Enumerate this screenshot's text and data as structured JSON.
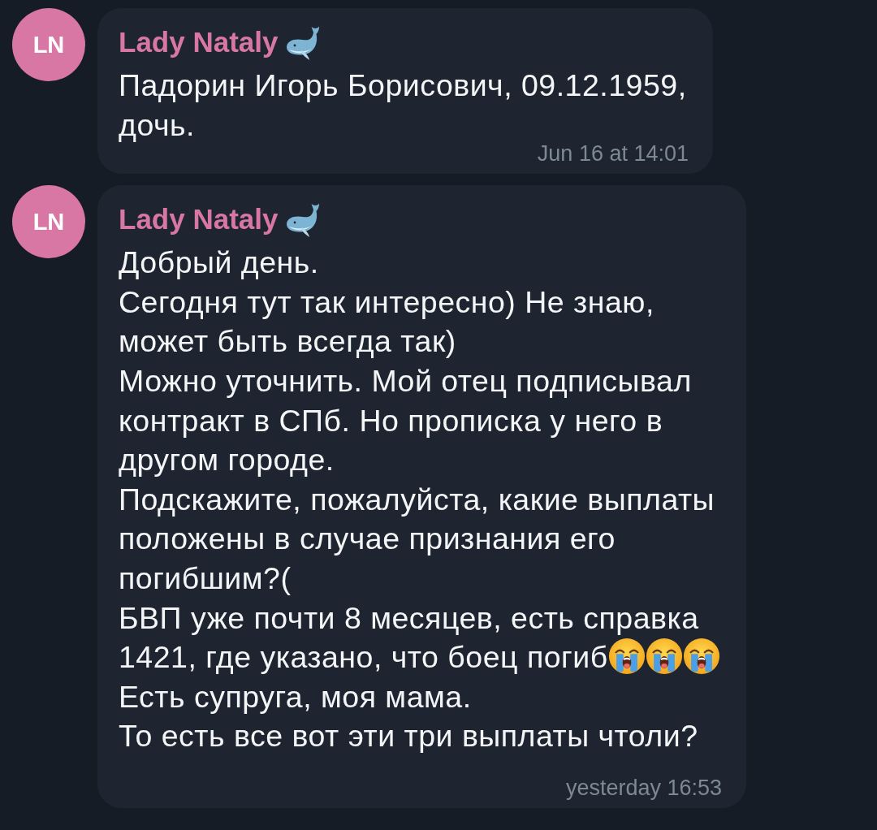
{
  "messages": [
    {
      "avatar": {
        "initials": "LN"
      },
      "sender": {
        "name": "Lady Nataly",
        "badge_emoji": {
          "kind": "whale"
        }
      },
      "paragraphs": [
        {
          "text": "Падорин Игорь Борисович, 09.12.1959, дочь."
        }
      ],
      "time": "Jun 16 at 14:01"
    },
    {
      "avatar": {
        "initials": "LN"
      },
      "sender": {
        "name": "Lady Nataly",
        "badge_emoji": {
          "kind": "whale"
        }
      },
      "paragraphs": [
        {
          "text": "Добрый день."
        },
        {
          "text": "Сегодня тут так интересно) Не знаю, может быть всегда так)"
        },
        {
          "text": "Можно уточнить. Мой отец подписывал контракт в СПб. Но прописка у него в другом городе."
        },
        {
          "text": "Подскажите, пожалуйста, какие выплаты положены в случае признания его погибшим?("
        },
        {
          "text": "БВП уже почти 8 месяцев, есть справка"
        },
        {
          "text": "1421, где указано, что боец погиб",
          "emoji": [
            {
              "kind": "loudly-crying"
            },
            {
              "kind": "loudly-crying"
            },
            {
              "kind": "loudly-crying"
            }
          ]
        },
        {
          "text": "Есть супруга, моя мама."
        },
        {
          "text": "То есть все вот эти три выплаты чтоли?"
        }
      ],
      "time": "yesterday 16:53"
    }
  ]
}
